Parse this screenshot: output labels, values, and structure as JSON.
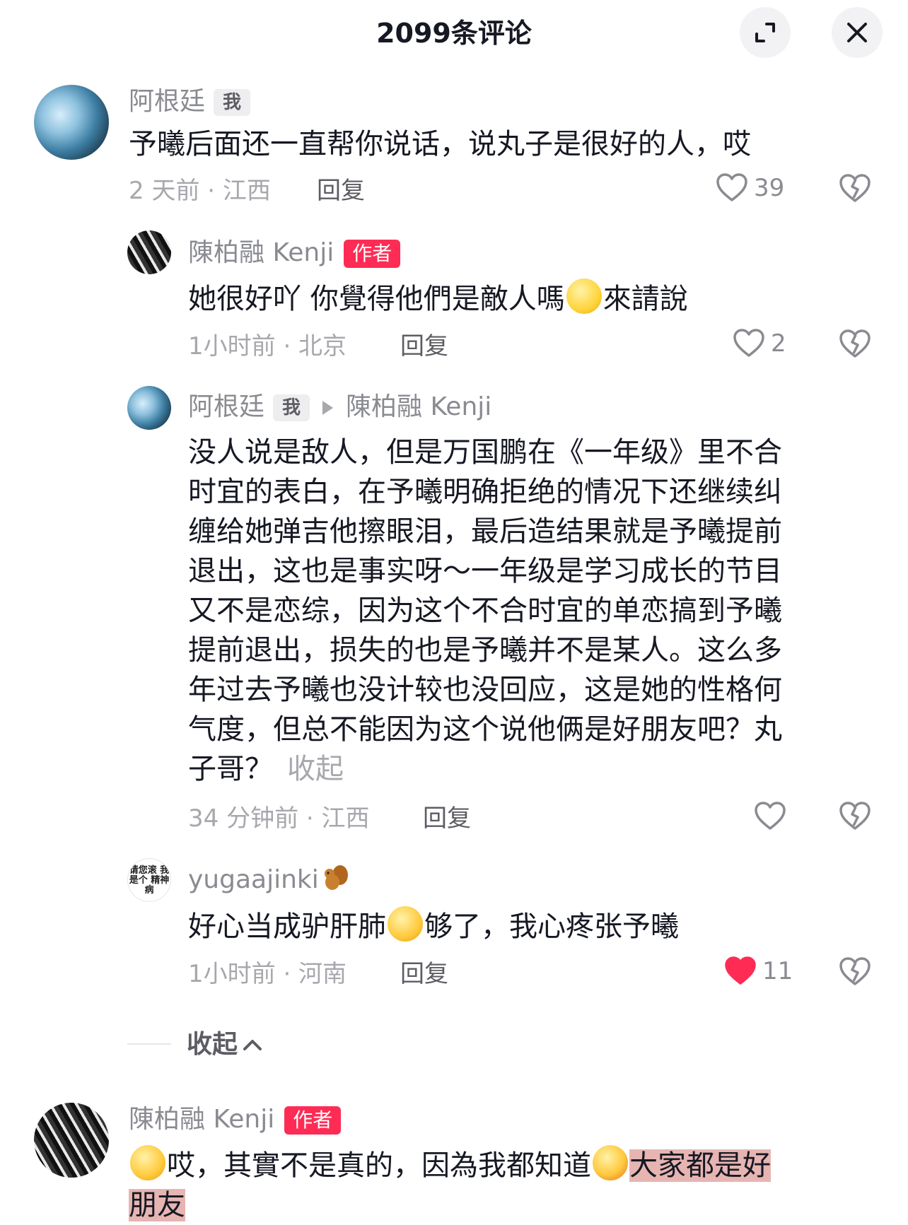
{
  "header": {
    "title": "2099条评论"
  },
  "comments": [
    {
      "user": "阿根廷",
      "badge": "我",
      "text": "予曦后面还一直帮你说话，说丸子是很好的人，哎",
      "time_location": "2 天前 · 江西",
      "reply_label": "回复",
      "likes": "39"
    }
  ],
  "replies": [
    {
      "user": "陳柏融 Kenji",
      "badge": "作者",
      "text_before": "她很好吖 你覺得他們是敵人嗎",
      "text_after": "來請說",
      "time_location": "1小时前 · 北京",
      "reply_label": "回复",
      "likes": "2"
    },
    {
      "user": "阿根廷",
      "badge": "我",
      "reply_to": "陳柏融 Kenji",
      "lines": [
        "没人说是敌人，但是万国鹏在《一年级》里不合",
        "时宜的表白，在予曦明确拒绝的情况下还继续纠",
        "缠给她弹吉他擦眼泪，最后造结果就是予曦提前",
        "退出，这也是事实呀～一年级是学习成长的节目",
        "又不是恋综，因为这个不合时宜的单恋搞到予曦",
        "提前退出，损失的也是予曦并不是某人。这么多",
        "年过去予曦也没计较也没回应，这是她的性格何",
        "气度，但总不能因为这个说他俩是好朋友吧？丸"
      ],
      "last_line": "子哥？",
      "collapse_label": "收起",
      "time_location": "34 分钟前 · 江西",
      "reply_label": "回复"
    },
    {
      "user": "yugaajinki",
      "avatar_text": "请您滚 我是个 精神病",
      "text_before": "好心当成驴肝肺",
      "text_after": "够了，我心疼张予曦",
      "time_location": "1小时前 · 河南",
      "reply_label": "回复",
      "likes": "11",
      "liked": true
    }
  ],
  "collapse_replies_label": "收起",
  "last_comment": {
    "user": "陳柏融 Kenji",
    "badge": "作者",
    "text_a": "哎，其實不是真的，因為我都知道",
    "text_b": "大家都是好",
    "text_c": "朋友"
  },
  "colors": {
    "accent": "#fe2c55",
    "muted": "#a7a8ad",
    "highlight": "#d2787380"
  },
  "icons": [
    "expand-icon",
    "close-icon",
    "heart-icon",
    "dislike-heart-icon",
    "squirrel-emoji-icon",
    "chevron-up-icon"
  ]
}
